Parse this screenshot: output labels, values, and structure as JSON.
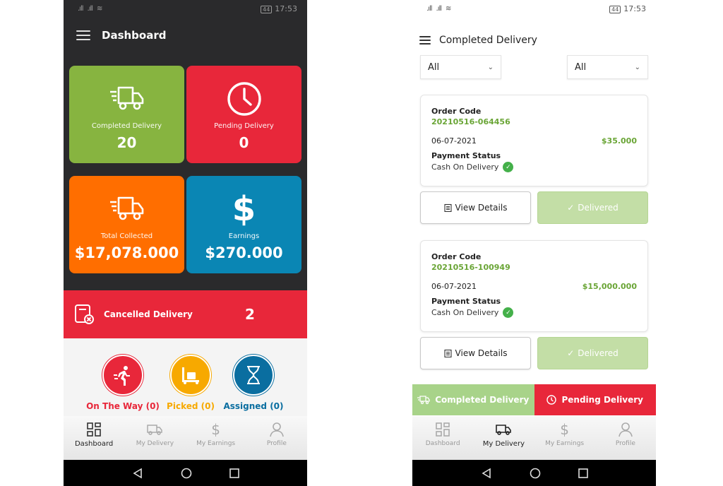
{
  "left": {
    "status": {
      "time": "17:53",
      "battery": "44"
    },
    "header": {
      "title": "Dashboard"
    },
    "tiles": [
      {
        "label": "Completed Delivery",
        "value": "20",
        "color": "#87b440",
        "icon": "truck-icon"
      },
      {
        "label": "Pending Delivery",
        "value": "0",
        "color": "#e8273a",
        "icon": "clock-icon"
      },
      {
        "label": "Total Collected",
        "value": "$17,078.000",
        "color": "#ff6e00",
        "icon": "truck-icon"
      },
      {
        "label": "Earnings",
        "value": "$270.000",
        "color": "#0a86b4",
        "icon": "dollar-icon"
      }
    ],
    "cancelled": {
      "label": "Cancelled Delivery",
      "value": "2"
    },
    "statuses": [
      {
        "label": "On The Way (0)",
        "color": "#e8273a",
        "icon": "running-icon"
      },
      {
        "label": "Picked (0)",
        "color": "#f7a900",
        "icon": "package-cart-icon"
      },
      {
        "label": "Assigned (0)",
        "color": "#0a6ea0",
        "icon": "hourglass-icon"
      }
    ],
    "nav": [
      {
        "label": "Dashboard",
        "icon": "grid-icon",
        "active": true
      },
      {
        "label": "My Delivery",
        "icon": "truck-icon",
        "active": false
      },
      {
        "label": "My Earnings",
        "icon": "dollar-icon",
        "active": false
      },
      {
        "label": "Profile",
        "icon": "user-icon",
        "active": false
      }
    ]
  },
  "right": {
    "status": {
      "time": "17:53",
      "battery": "44"
    },
    "header": {
      "title": "Completed Delivery"
    },
    "filters": [
      {
        "value": "All"
      },
      {
        "value": "All"
      }
    ],
    "orders": [
      {
        "order_code_label": "Order Code",
        "order_code": "20210516-064456",
        "date": "06-07-2021",
        "amount": "$35.000",
        "payment_status_label": "Payment Status",
        "payment_method": "Cash On Delivery"
      },
      {
        "order_code_label": "Order Code",
        "order_code": "20210516-100949",
        "date": "06-07-2021",
        "amount": "$15,000.000",
        "payment_status_label": "Payment Status",
        "payment_method": "Cash On Delivery"
      }
    ],
    "buttons": {
      "view_details": "View Details",
      "delivered": "Delivered"
    },
    "tabs": {
      "completed": "Completed Delivery",
      "pending": "Pending Delivery"
    },
    "nav": [
      {
        "label": "Dashboard",
        "icon": "grid-icon",
        "active": false
      },
      {
        "label": "My Delivery",
        "icon": "truck-icon",
        "active": true
      },
      {
        "label": "My Earnings",
        "icon": "dollar-icon",
        "active": false
      },
      {
        "label": "Profile",
        "icon": "user-icon",
        "active": false
      }
    ]
  }
}
